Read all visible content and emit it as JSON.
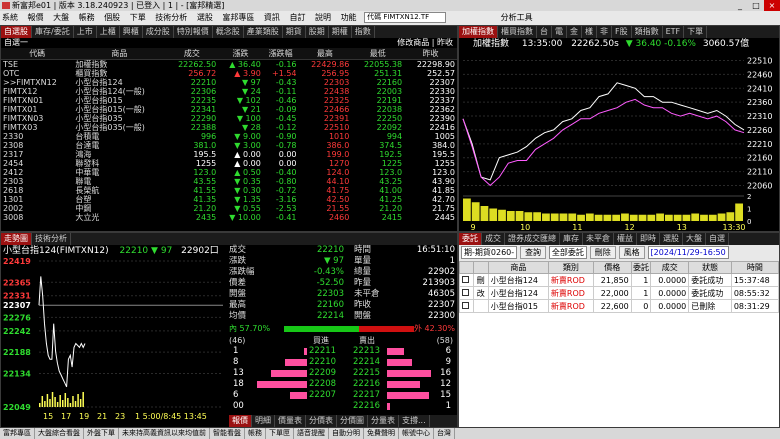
{
  "window": {
    "title": "新富邦e01 | 版本 3.18.240923 | 已登入 | 1 | - [富邦精選]",
    "controls": [
      "_",
      "□",
      "×"
    ]
  },
  "menu": {
    "items": [
      "系統",
      "報價",
      "大盤",
      "帳務",
      "個股",
      "下單",
      "技術分析",
      "選股",
      "富邦專區",
      "資訊",
      "自訂",
      "說明",
      "功能"
    ],
    "code_box": "代碼 FIMTXN12.TF",
    "tool": "分析工具"
  },
  "quote": {
    "tabs": [
      "自選股",
      "庫存/委託",
      "上市",
      "上櫃",
      "興櫃",
      "成分股",
      "特別報價",
      "概念股",
      "產業類股",
      "期貨",
      "股期",
      "期權",
      "指數"
    ],
    "group_label": "自選一",
    "right_label": "修改商品 | 昨收",
    "columns": [
      "代碼",
      "商品",
      "成交",
      "漲跌",
      "漲跌幅",
      "最高",
      "最低",
      "昨收"
    ],
    "rows": [
      {
        "code": "TSE",
        "name": "加權指數",
        "last": "22262.50",
        "arrow": "▲",
        "chg": "36.40",
        "pct": "-0.16",
        "high": "22429.86",
        "low": "22055.38",
        "prev": "22298.90",
        "dir": "dn"
      },
      {
        "code": "OTC",
        "name": "櫃買指數",
        "last": "256.72",
        "arrow": "▲",
        "chg": "3.90",
        "pct": "+1.54",
        "high": "256.95",
        "low": "251.31",
        "prev": "252.57",
        "dir": "up"
      },
      {
        "code": ">>FIMTXN12",
        "name": "小型台指124",
        "last": "22210",
        "arrow": "▼",
        "chg": "97",
        "pct": "-0.43",
        "high": "22303",
        "low": "22160",
        "prev": "22307",
        "dir": "dn"
      },
      {
        "code": "FIMTX12",
        "name": "小型台指124(一般)",
        "last": "22306",
        "arrow": "▼",
        "chg": "24",
        "pct": "-0.11",
        "high": "22438",
        "low": "22003",
        "prev": "22330",
        "dir": "dn"
      },
      {
        "code": "FIMTXN01",
        "name": "小型台指015",
        "last": "22235",
        "arrow": "▼",
        "chg": "102",
        "pct": "-0.46",
        "high": "22325",
        "low": "22191",
        "prev": "22337",
        "dir": "dn"
      },
      {
        "code": "FIMTX01",
        "name": "小型台指015(一般)",
        "last": "22341",
        "arrow": "▼",
        "chg": "21",
        "pct": "-0.09",
        "high": "22466",
        "low": "22038",
        "prev": "22362",
        "dir": "dn"
      },
      {
        "code": "FIMTXN03",
        "name": "小型台指035",
        "last": "22290",
        "arrow": "▼",
        "chg": "100",
        "pct": "-0.45",
        "high": "22391",
        "low": "22250",
        "prev": "22390",
        "dir": "dn"
      },
      {
        "code": "FIMTX03",
        "name": "小型台指035(一般)",
        "last": "22388",
        "arrow": "▼",
        "chg": "28",
        "pct": "-0.12",
        "high": "22510",
        "low": "22092",
        "prev": "22416",
        "dir": "dn"
      },
      {
        "code": "2330",
        "name": "台積電",
        "last": "996",
        "arrow": "▼",
        "chg": "9.00",
        "pct": "-0.90",
        "high": "1010",
        "low": "994",
        "prev": "1005",
        "dir": "dn"
      },
      {
        "code": "2308",
        "name": "台達電",
        "last": "381.0",
        "arrow": "▼",
        "chg": "3.00",
        "pct": "-0.78",
        "high": "386.0",
        "low": "374.5",
        "prev": "384.0",
        "dir": "dn"
      },
      {
        "code": "2317",
        "name": "鴻海",
        "last": "195.5",
        "arrow": "▲",
        "chg": "0.00",
        "pct": "0.00",
        "high": "199.0",
        "low": "192.5",
        "prev": "195.5",
        "dir": "flat"
      },
      {
        "code": "2454",
        "name": "聯發科",
        "last": "1255",
        "arrow": "▲",
        "chg": "0.00",
        "pct": "0.00",
        "high": "1270",
        "low": "1225",
        "prev": "1255",
        "dir": "flat"
      },
      {
        "code": "2412",
        "name": "中華電",
        "last": "123.0",
        "arrow": "▲",
        "chg": "0.50",
        "pct": "-0.40",
        "high": "124.0",
        "low": "123.0",
        "prev": "123.0",
        "dir": "dn"
      },
      {
        "code": "2303",
        "name": "聯電",
        "last": "43.55",
        "arrow": "▼",
        "chg": "0.35",
        "pct": "-0.80",
        "high": "44.10",
        "low": "43.25",
        "prev": "43.90",
        "dir": "dn"
      },
      {
        "code": "2618",
        "name": "長榮航",
        "last": "41.55",
        "arrow": "▼",
        "chg": "0.30",
        "pct": "-0.72",
        "high": "41.75",
        "low": "41.00",
        "prev": "41.85",
        "dir": "dn"
      },
      {
        "code": "1301",
        "name": "台塑",
        "last": "41.35",
        "arrow": "▼",
        "chg": "1.35",
        "pct": "-3.16",
        "high": "42.50",
        "low": "41.25",
        "prev": "42.70",
        "dir": "dn"
      },
      {
        "code": "2002",
        "name": "中鋼",
        "last": "21.20",
        "arrow": "▼",
        "chg": "0.55",
        "pct": "-2.53",
        "high": "21.55",
        "low": "21.20",
        "prev": "21.75",
        "dir": "dn"
      },
      {
        "code": "3008",
        "name": "大立光",
        "last": "2435",
        "arrow": "▼",
        "chg": "10.00",
        "pct": "-0.41",
        "high": "2460",
        "low": "2415",
        "prev": "2445",
        "dir": "dn"
      }
    ]
  },
  "index_chart": {
    "tabs": [
      "加權指數",
      "櫃買指數",
      "台",
      "電",
      "金",
      "樣",
      "非",
      "F股",
      "類指數",
      "ETF",
      "下單"
    ],
    "header": {
      "name": "加權指數",
      "time": "13:35:00",
      "value": "22262.50s",
      "arrow": "▼",
      "chg": "36.40",
      "pct": "-0.16%",
      "vol": "3060.57億"
    }
  },
  "chart_data": {
    "type": "line",
    "x_ticks": [
      "9",
      "10",
      "11",
      "12",
      "13",
      "13:30"
    ],
    "y_ticks": [
      "22510",
      "22460",
      "22410",
      "22360",
      "22310",
      "22260",
      "22210",
      "22160",
      "22110",
      "22060"
    ],
    "ylim": [
      22040,
      22530
    ],
    "series": [
      {
        "color": "#ffffff",
        "values": [
          22300,
          22210,
          22090,
          22080,
          22160,
          22170,
          22180,
          22200,
          22230,
          22250,
          22260,
          22290,
          22300,
          22330,
          22340,
          22380,
          22390,
          22430,
          22420,
          22410,
          22380,
          22380,
          22360,
          22360,
          22350,
          22340,
          22330,
          22320,
          22330,
          22310,
          22280,
          22260
        ]
      },
      {
        "color": "#ff5cff",
        "values": [
          22300,
          22200,
          22090,
          22060,
          22090,
          22140,
          22150,
          22150,
          22190,
          22210,
          22230,
          22260,
          22280,
          22300,
          22300,
          22320,
          22330,
          22340,
          22360,
          22370,
          22350,
          22340,
          22340,
          22320,
          22310,
          22320,
          22310,
          22300,
          22310,
          22290,
          22260,
          22250
        ]
      }
    ],
    "volume_ticks": [
      "2",
      "1",
      "0"
    ],
    "volume_values": [
      1.8,
      1.5,
      1.2,
      1.0,
      0.9,
      0.8,
      0.8,
      0.7,
      0.7,
      0.6,
      0.6,
      0.6,
      0.6,
      0.5,
      0.6,
      0.5,
      0.5,
      0.5,
      0.6,
      0.5,
      0.5,
      0.5,
      0.6,
      0.5,
      0.5,
      0.5,
      0.6,
      0.5,
      0.5,
      0.6,
      0.7,
      1.4
    ]
  },
  "tick_chart": {
    "tabs": [
      "走勢圖",
      "技術分析"
    ],
    "title": "小型台指124(FIMTXN12)",
    "last": "22210",
    "arrow": "▼",
    "chg": "97",
    "prev": "22902口",
    "y_labels": [
      "22419",
      "22365",
      "22331",
      "22307",
      "22276",
      "22242",
      "22188",
      "22134",
      "22049"
    ],
    "bottom_labels": [
      "15",
      "17",
      "19",
      "21",
      "23"
    ],
    "time_label": "1 5:00/8:45 13:45",
    "values": [
      22307,
      22380,
      22330,
      22260,
      22210,
      22180,
      22170,
      22170,
      22260,
      22190,
      22160,
      22140,
      22130,
      22120,
      22110,
      22100,
      22170,
      22180,
      22150,
      22200,
      22210,
      22205,
      22200,
      22210,
      22200,
      22210
    ]
  },
  "detail": {
    "rows": [
      {
        "k": "成交",
        "v": "22210",
        "k2": "時間",
        "v2": "16:51:10"
      },
      {
        "k": "漲跌",
        "v": "▼ 97",
        "k2": "單量",
        "v2": "1"
      },
      {
        "k": "漲跌幅",
        "v": "-0.43%",
        "k2": "總量",
        "v2": "22902"
      },
      {
        "k": "價差",
        "v": "-52.50",
        "k2": "昨量",
        "v2": "213903"
      },
      {
        "k": "開盤",
        "v": "22303",
        "k2": "未平倉",
        "v2": "46305"
      },
      {
        "k": "最高",
        "v": "22160",
        "k2": "昨收",
        "v2": "22307"
      },
      {
        "k": "均價",
        "v": "22214",
        "k2": "開盤",
        "v2": "22300"
      }
    ],
    "inner_label": "內 57.70%",
    "outer_label": "外 42.30%",
    "inner_pct": 0.577,
    "bid_count": "(46)",
    "ask_count": "(58)",
    "bid_head": "買進",
    "ask_head": "賣出",
    "book": [
      {
        "bq": "1",
        "bp": "22211",
        "ap": "22213",
        "aq": "6"
      },
      {
        "bq": "8",
        "bp": "22210",
        "ap": "22214",
        "aq": "9"
      },
      {
        "bq": "13",
        "bp": "22209",
        "ap": "22215",
        "aq": "16"
      },
      {
        "bq": "18",
        "bp": "22208",
        "ap": "22216",
        "aq": "12"
      },
      {
        "bq": "6",
        "bp": "22207",
        "ap": "22217",
        "aq": "15"
      },
      {
        "bq": "00",
        "bp": "",
        "ap": "22216",
        "aq": "1"
      }
    ],
    "bottom_tabs": [
      "報價",
      "明細",
      "價量表",
      "分價表",
      "分價圖",
      "分量表",
      "支撐..."
    ]
  },
  "order": {
    "tabs": [
      "委託",
      "成交",
      "證券成交匯總",
      "庫存",
      "未平倉",
      "權益",
      "即時",
      "選股",
      "大盤",
      "自選"
    ],
    "account": "期-期貨0260-",
    "query": "查詢",
    "filter": "全部委託",
    "delete": "刪除",
    "style": "風格",
    "date": "[2024/11/29-16:50",
    "columns": [
      "",
      "",
      "商品",
      "類別",
      "價格",
      "委託",
      "成交",
      "狀態",
      "時間"
    ],
    "rows": [
      {
        "act": "刪",
        "item": "小型台指124",
        "type": "新賣ROD",
        "price": "21,850",
        "qty": "1",
        "fill": "0.0000",
        "status": "委託成功",
        "time": "15:37:48"
      },
      {
        "act": "改",
        "item": "小型台指124",
        "type": "新賣ROD",
        "price": "22,000",
        "qty": "1",
        "fill": "0.0000",
        "status": "委託成功",
        "time": "08:55:32"
      },
      {
        "act": "",
        "item": "小型台指015",
        "type": "新賣ROD",
        "price": "22,600",
        "qty": "0",
        "fill": "0.0000",
        "status": "已刪除",
        "time": "08:31:29"
      }
    ]
  },
  "status": {
    "items": [
      "富邦專區",
      "大盤綜合看盤",
      "外盤下單",
      "未來持高義資訊以來均值前",
      "智能看盤",
      "帳務",
      "下單匣",
      "語音提醒",
      "自動分明",
      "免費聲明",
      "帳號中心",
      "台灣"
    ]
  }
}
